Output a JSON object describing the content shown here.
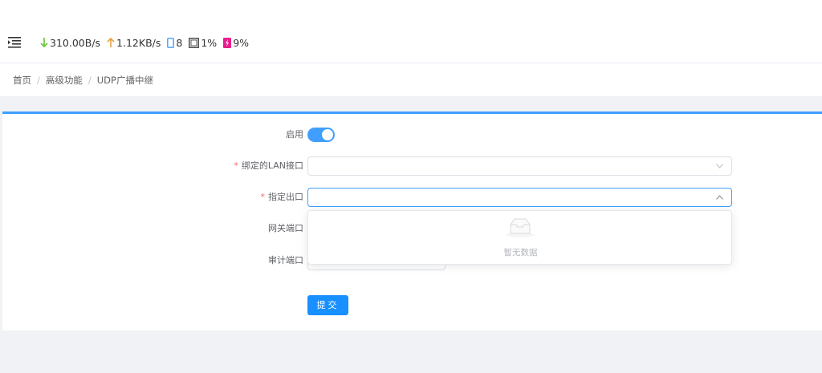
{
  "topbar": {
    "download_speed": "310.00B/s",
    "upload_speed": "1.12KB/s",
    "devices": "8",
    "cpu": "1%",
    "memory": "9%"
  },
  "breadcrumb": {
    "items": [
      "首页",
      "高级功能",
      "UDP广播中继"
    ],
    "separator": "/"
  },
  "form": {
    "enable_label": "启用",
    "enable_on": true,
    "lan_label": "绑定的LAN接口",
    "lan_value": "",
    "out_label": "指定出口",
    "out_value": "",
    "gateway_label": "网关端口",
    "audit_label": "审计端口",
    "required_mark": "*",
    "submit_label": "提交"
  },
  "dropdown": {
    "empty_text": "暂无数据"
  },
  "colors": {
    "accent": "#409eff",
    "download": "#67c23a",
    "upload": "#e6a23c",
    "memory": "#e91e8c"
  }
}
